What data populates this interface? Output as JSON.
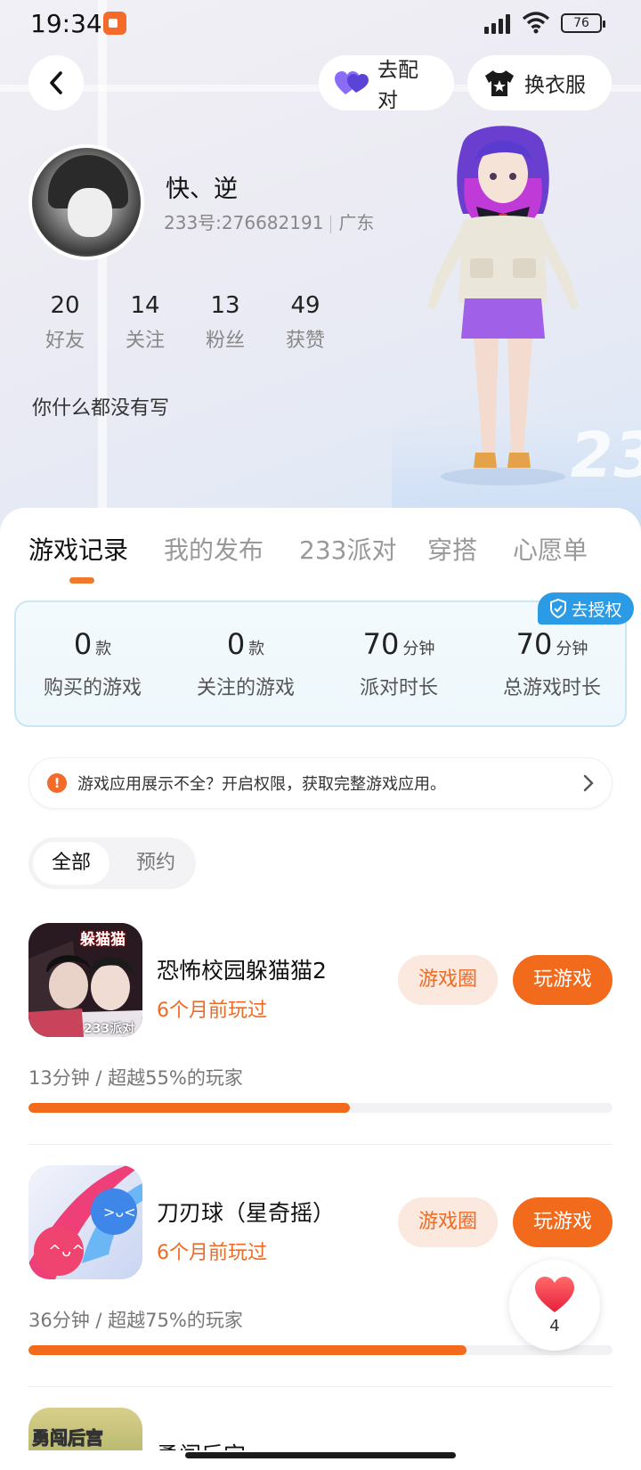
{
  "status_bar": {
    "time": "19:34",
    "battery": "76"
  },
  "header": {
    "pair_label": "去配对",
    "dress_label": "换衣服"
  },
  "profile": {
    "nickname": "快、逆",
    "uid": "233号:276682191",
    "region": "广东",
    "bio": "你什么都没有写",
    "stats": [
      {
        "num": "20",
        "label": "好友"
      },
      {
        "num": "14",
        "label": "关注"
      },
      {
        "num": "13",
        "label": "粉丝"
      },
      {
        "num": "49",
        "label": "获赞"
      }
    ]
  },
  "tabs": [
    {
      "label": "游戏记录"
    },
    {
      "label": "我的发布"
    },
    {
      "label": "233派对"
    },
    {
      "label": "穿搭"
    },
    {
      "label": "心愿单"
    }
  ],
  "summary": {
    "auth_label": "去授权",
    "items": [
      {
        "value": "0",
        "unit": "款",
        "label": "购买的游戏"
      },
      {
        "value": "0",
        "unit": "款",
        "label": "关注的游戏"
      },
      {
        "value": "70",
        "unit": "分钟",
        "label": "派对时长"
      },
      {
        "value": "70",
        "unit": "分钟",
        "label": "总游戏时长"
      }
    ]
  },
  "notice": {
    "text": "游戏应用展示不全？开启权限，获取完整游戏应用。"
  },
  "filter": {
    "all": "全部",
    "reserve": "预约"
  },
  "games": [
    {
      "name": "恐怖校园躲猫猫2",
      "played": "6个月前玩过",
      "circle_label": "游戏圈",
      "play_label": "玩游戏",
      "duration": "13分钟 / 超越55%的玩家",
      "progress": 0.55,
      "icon_text_top": "躲猫猫",
      "icon_text_bottom": "233派对"
    },
    {
      "name": "刀刃球（星奇摇）",
      "played": "6个月前玩过",
      "circle_label": "游戏圈",
      "play_label": "玩游戏",
      "duration": "36分钟 / 超越75%的玩家",
      "progress": 0.75
    },
    {
      "name": "勇闯后宫",
      "icon_text_top": "勇闯后宫"
    }
  ],
  "like": {
    "count": "4"
  }
}
